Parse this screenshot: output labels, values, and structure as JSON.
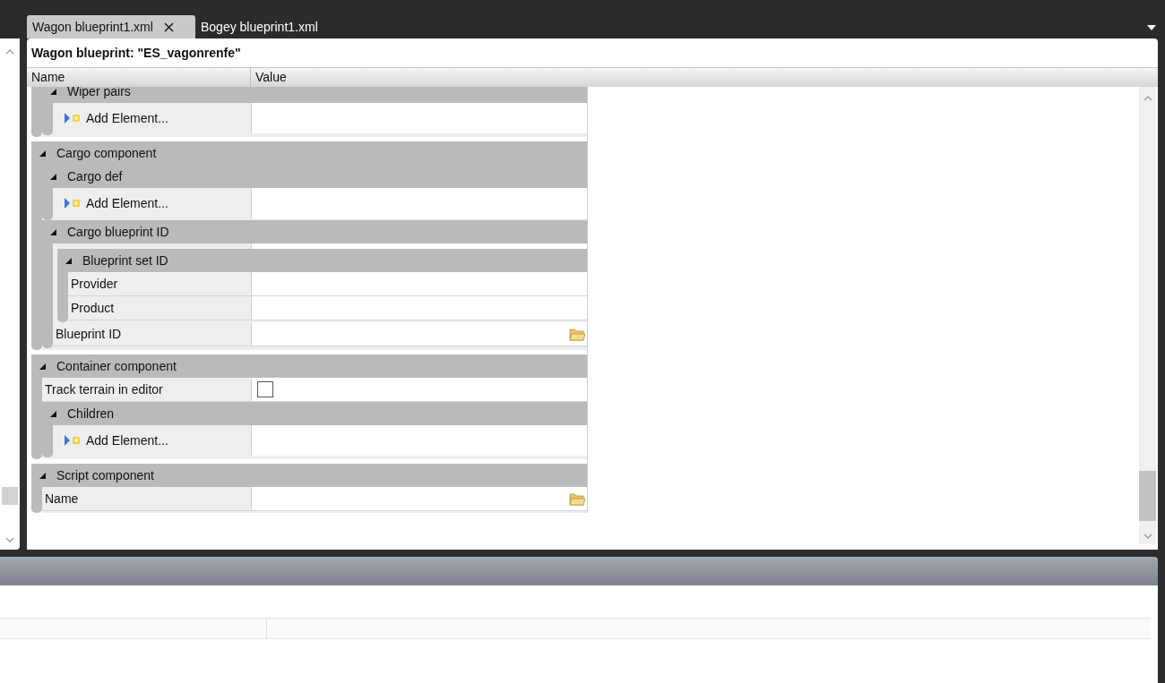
{
  "tabs": [
    {
      "label": "Wagon blueprint1.xml",
      "selected": true
    },
    {
      "label": "Bogey blueprint1.xml",
      "selected": false
    }
  ],
  "document": {
    "title": "Wagon blueprint: \"ES_vagonrenfe\"",
    "columns": [
      "Name",
      "Value"
    ],
    "rows": [
      {
        "kind": "continuation",
        "children": [
          {
            "kind": "group",
            "label": "Wiper pairs",
            "expanded": true,
            "children": [
              {
                "kind": "add",
                "label": "Add Element..."
              }
            ]
          }
        ]
      },
      {
        "kind": "group",
        "label": "Cargo component",
        "expanded": true,
        "children": [
          {
            "kind": "group",
            "label": "Cargo def",
            "expanded": true,
            "children": [
              {
                "kind": "add",
                "label": "Add Element..."
              }
            ]
          },
          {
            "kind": "group",
            "label": "Cargo blueprint ID",
            "expanded": true,
            "children": [
              {
                "kind": "group",
                "label": "Blueprint set ID",
                "expanded": true,
                "children": [
                  {
                    "kind": "text_field",
                    "label": "Provider"
                  },
                  {
                    "kind": "text_field",
                    "label": "Product"
                  }
                ]
              },
              {
                "kind": "folder_field",
                "label": "Blueprint ID"
              }
            ]
          }
        ]
      },
      {
        "kind": "group",
        "label": "Container component",
        "expanded": true,
        "children": [
          {
            "kind": "checkbox_field",
            "label": "Track terrain in editor",
            "checked": false
          },
          {
            "kind": "group",
            "label": "Children",
            "expanded": true,
            "children": [
              {
                "kind": "add",
                "label": "Add Element..."
              }
            ]
          }
        ]
      },
      {
        "kind": "group",
        "label": "Script component",
        "expanded": true,
        "children": [
          {
            "kind": "folder_field",
            "label": "Name"
          }
        ]
      }
    ]
  }
}
